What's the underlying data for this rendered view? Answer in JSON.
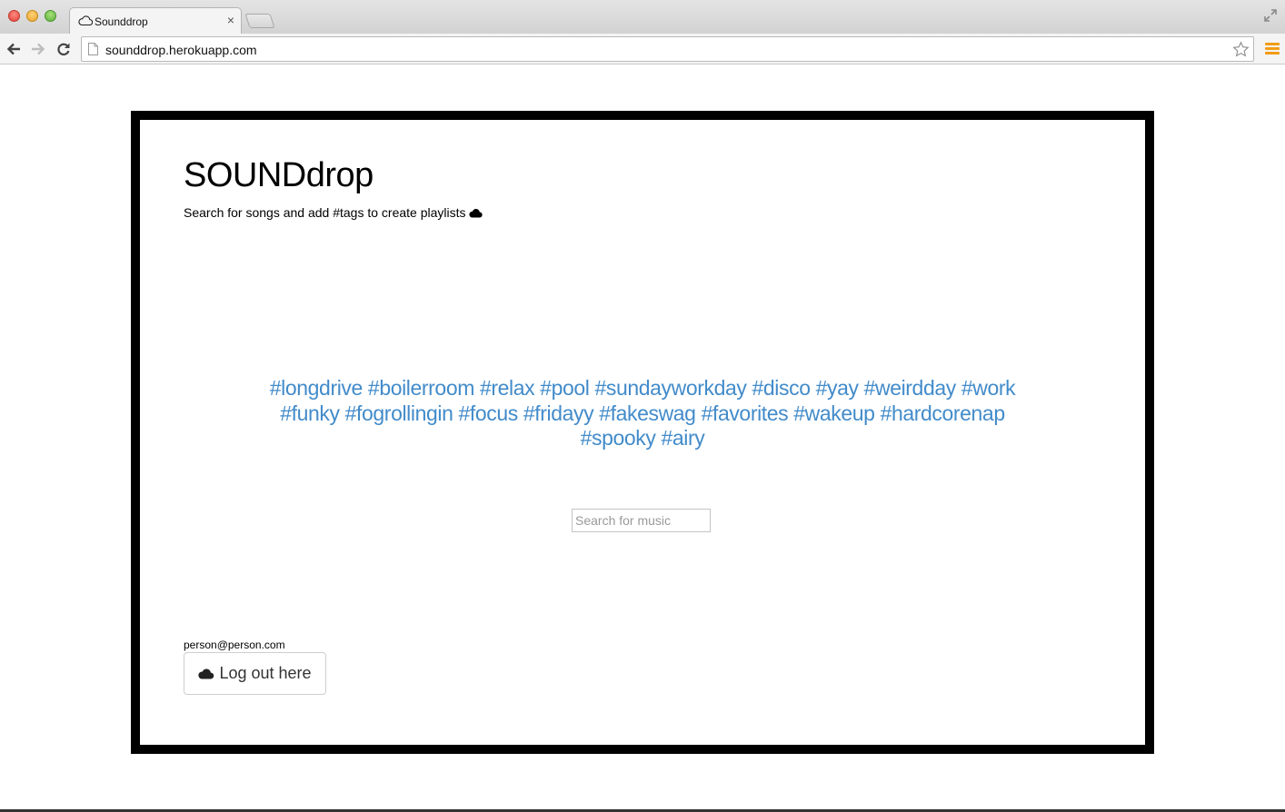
{
  "browser": {
    "tab_title": "Sounddrop",
    "tab_close": "×",
    "url": "sounddrop.herokuapp.com",
    "accent_color": "#f39c12"
  },
  "page": {
    "site_title": "SOUNDdrop",
    "tagline": "Search for songs and add #tags to create playlists",
    "tag_color": "#428bca",
    "tags": [
      "#longdrive",
      "#boilerroom",
      "#relax",
      "#pool",
      "#sundayworkday",
      "#disco",
      "#yay",
      "#weirdday",
      "#work",
      "#funky",
      "#fogrollingin",
      "#focus",
      "#fridayy",
      "#fakeswag",
      "#favorites",
      "#wakeup",
      "#hardcorenap",
      "#spooky",
      "#airy"
    ],
    "search": {
      "placeholder": "Search for music",
      "value": ""
    },
    "user_email": "person@person.com",
    "logout_label": "Log out here",
    "icons": [
      "cloud-icon"
    ]
  }
}
